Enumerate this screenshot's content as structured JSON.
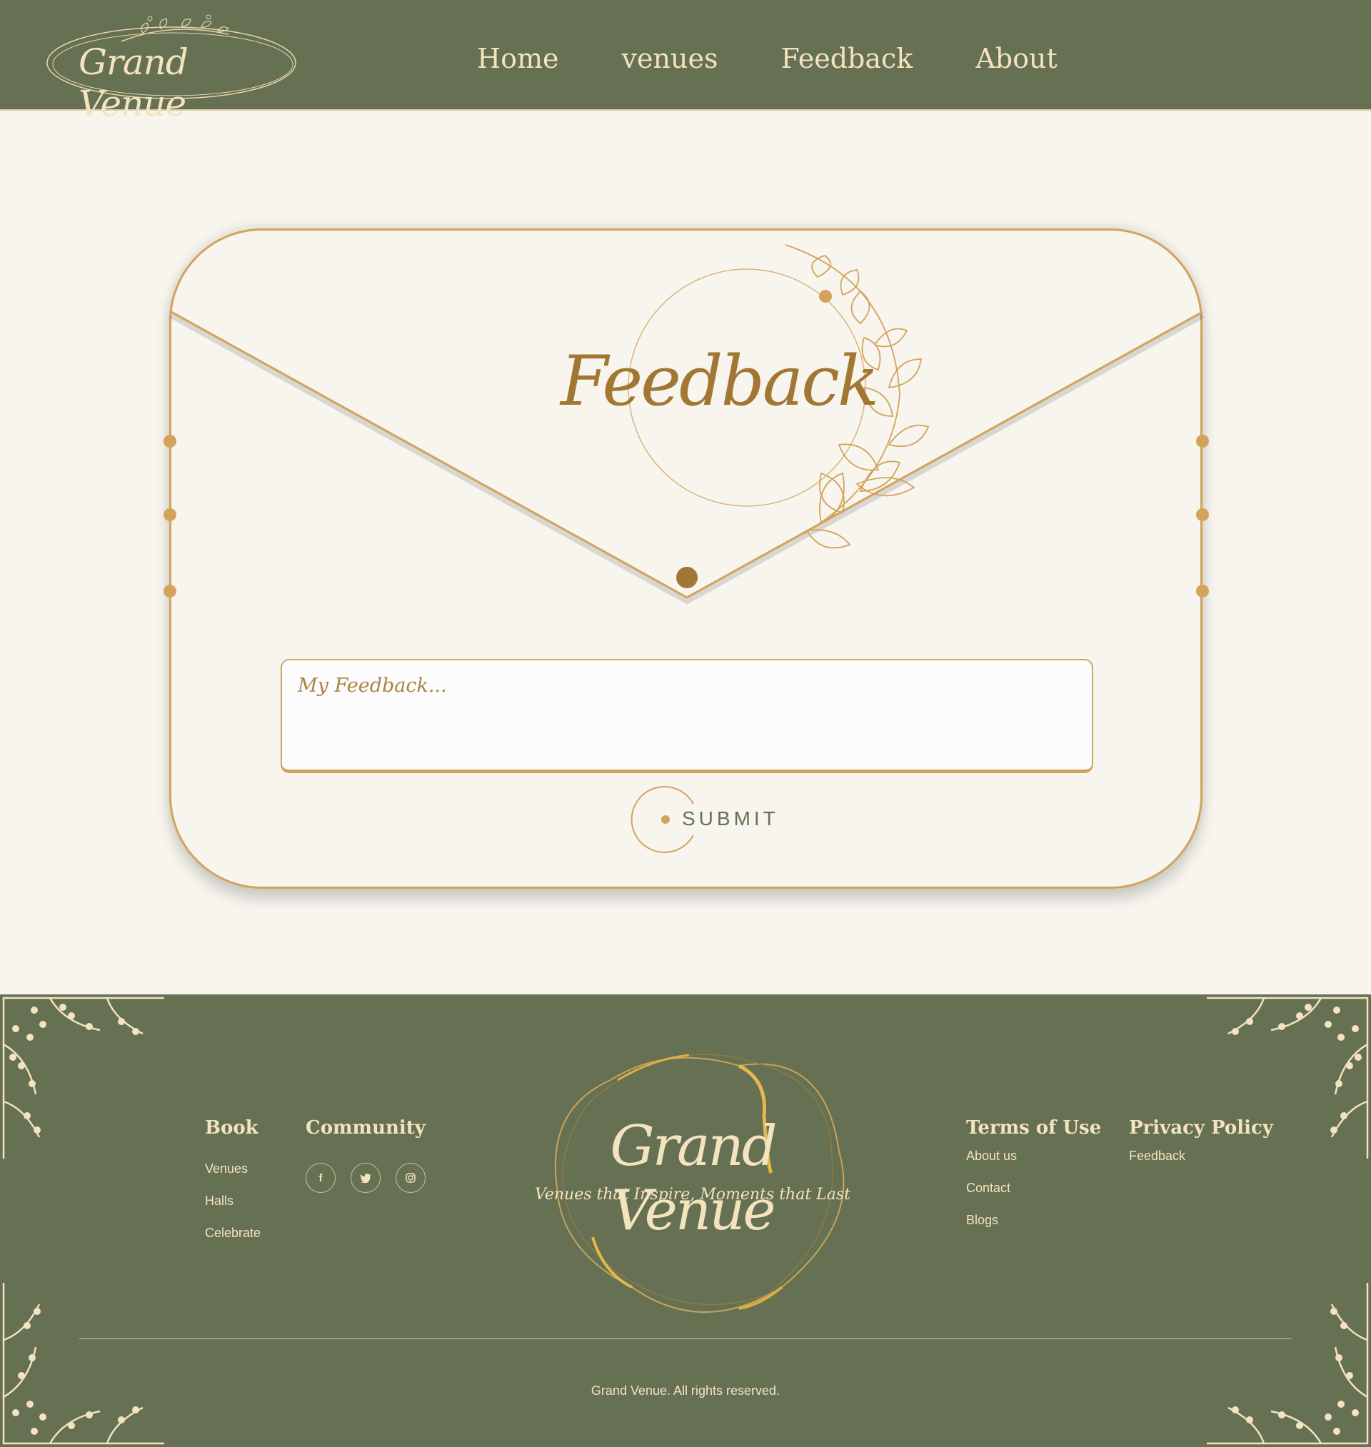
{
  "header": {
    "logo_text": "Grand Venue",
    "nav": [
      "Home",
      "venues",
      "Feedback",
      "About"
    ]
  },
  "feedback_card": {
    "title": "Feedback",
    "placeholder": "My Feedback...",
    "submit_label": "SUBMIT"
  },
  "footer": {
    "book": {
      "heading": "Book",
      "links": [
        "Venues",
        "Halls",
        "Celebrate"
      ]
    },
    "community": {
      "heading": "Community",
      "social_icons": [
        "facebook-icon",
        "twitter-icon",
        "instagram-icon"
      ]
    },
    "logo_title": "Grand Venue",
    "logo_tagline": "Venues that Inspire, Moments that Last",
    "terms": {
      "heading": "Terms of Use",
      "links": [
        "About us",
        "Contact",
        "Blogs"
      ]
    },
    "privacy": {
      "heading": "Privacy Policy",
      "links": [
        "Feedback"
      ]
    },
    "copyright": "Grand Venue. All rights reserved."
  },
  "colors": {
    "green": "#667052",
    "cream": "#f7f5ee",
    "gold": "#d3a35c",
    "dark_gold": "#a27733",
    "footer_text": "#f4e3bf"
  }
}
